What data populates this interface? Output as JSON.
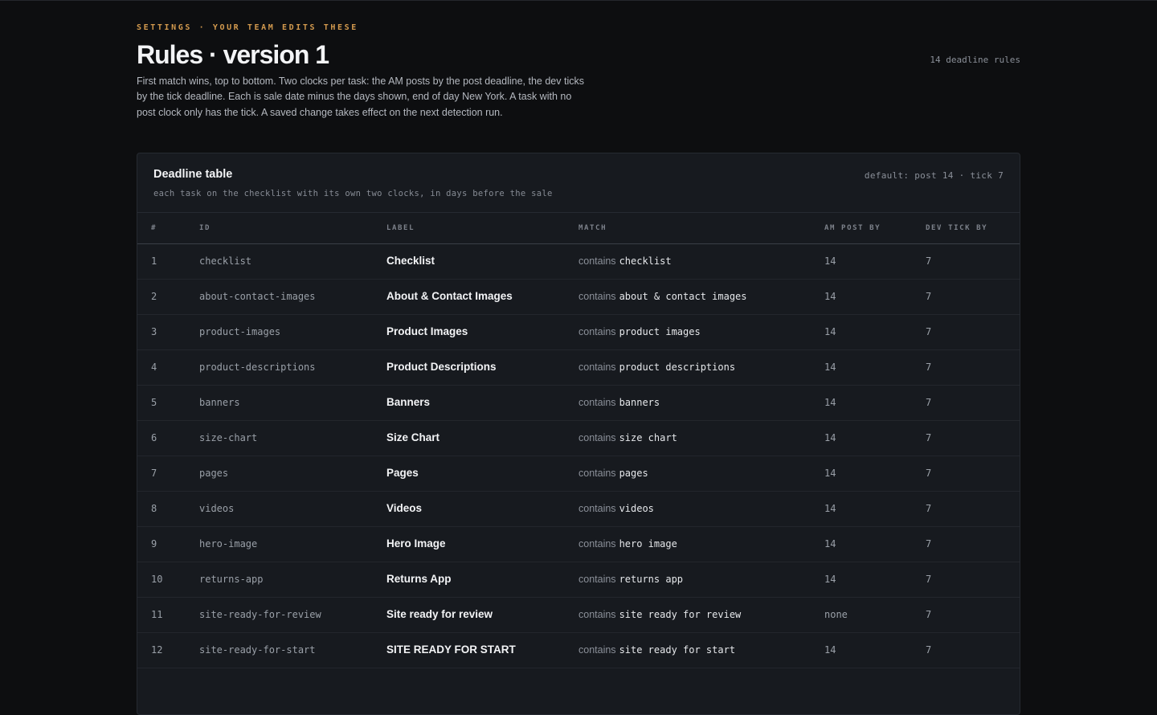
{
  "header": {
    "eyebrow": "SETTINGS · YOUR TEAM EDITS THESE",
    "title": "Rules · version 1",
    "rules_count": "14 deadline rules",
    "description": "First match wins, top to bottom. Two clocks per task: the AM posts by the post deadline, the dev ticks by the tick deadline. Each is sale date minus the days shown, end of day New York. A task with no post clock only has the tick. A saved change takes effect on the next detection run."
  },
  "table": {
    "title": "Deadline table",
    "subtitle": "each task on the checklist with its own two clocks, in days before the sale",
    "default": "default: post 14 · tick 7",
    "columns": [
      "#",
      "ID",
      "LABEL",
      "MATCH",
      "AM POST BY",
      "DEV TICK BY"
    ],
    "rows": [
      {
        "num": "1",
        "id": "checklist",
        "label": "Checklist",
        "match_op": "contains",
        "match_value": "checklist",
        "post": "14",
        "tick": "7"
      },
      {
        "num": "2",
        "id": "about-contact-images",
        "label": "About & Contact Images",
        "match_op": "contains",
        "match_value": "about & contact images",
        "post": "14",
        "tick": "7"
      },
      {
        "num": "3",
        "id": "product-images",
        "label": "Product Images",
        "match_op": "contains",
        "match_value": "product images",
        "post": "14",
        "tick": "7"
      },
      {
        "num": "4",
        "id": "product-descriptions",
        "label": "Product Descriptions",
        "match_op": "contains",
        "match_value": "product descriptions",
        "post": "14",
        "tick": "7"
      },
      {
        "num": "5",
        "id": "banners",
        "label": "Banners",
        "match_op": "contains",
        "match_value": "banners",
        "post": "14",
        "tick": "7"
      },
      {
        "num": "6",
        "id": "size-chart",
        "label": "Size Chart",
        "match_op": "contains",
        "match_value": "size chart",
        "post": "14",
        "tick": "7"
      },
      {
        "num": "7",
        "id": "pages",
        "label": "Pages",
        "match_op": "contains",
        "match_value": "pages",
        "post": "14",
        "tick": "7"
      },
      {
        "num": "8",
        "id": "videos",
        "label": "Videos",
        "match_op": "contains",
        "match_value": "videos",
        "post": "14",
        "tick": "7"
      },
      {
        "num": "9",
        "id": "hero-image",
        "label": "Hero Image",
        "match_op": "contains",
        "match_value": "hero image",
        "post": "14",
        "tick": "7"
      },
      {
        "num": "10",
        "id": "returns-app",
        "label": "Returns App",
        "match_op": "contains",
        "match_value": "returns app",
        "post": "14",
        "tick": "7"
      },
      {
        "num": "11",
        "id": "site-ready-for-review",
        "label": "Site ready for review",
        "match_op": "contains",
        "match_value": "site ready for review",
        "post": "none",
        "tick": "7"
      },
      {
        "num": "12",
        "id": "site-ready-for-start",
        "label": "SITE READY FOR START",
        "match_op": "contains",
        "match_value": "site ready for start",
        "post": "14",
        "tick": "7"
      }
    ]
  },
  "colors": {
    "background": "#0d0e10",
    "card": "#171a1f",
    "accent": "#d39a4e"
  }
}
